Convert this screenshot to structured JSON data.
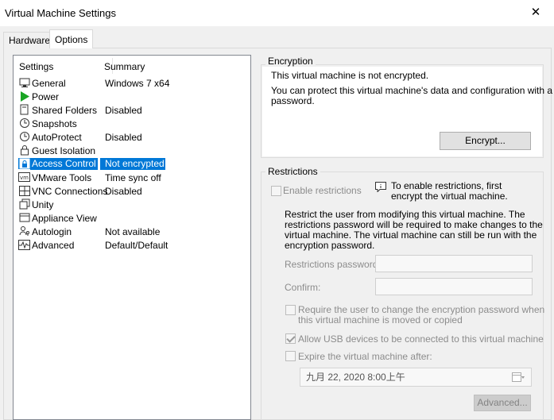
{
  "window": {
    "title": "Virtual Machine Settings"
  },
  "tabs": [
    {
      "label": "Hardware",
      "active": false
    },
    {
      "label": "Options",
      "active": true
    }
  ],
  "settings_list": {
    "columns": [
      "Settings",
      "Summary"
    ],
    "rows": [
      {
        "name": "General",
        "summary": "Windows 7 x64",
        "icon": "monitor-icon"
      },
      {
        "name": "Power",
        "summary": "",
        "icon": "play-icon"
      },
      {
        "name": "Shared Folders",
        "summary": "Disabled",
        "icon": "folder-icon"
      },
      {
        "name": "Snapshots",
        "summary": "",
        "icon": "snapshot-clock-icon"
      },
      {
        "name": "AutoProtect",
        "summary": "Disabled",
        "icon": "clock-icon"
      },
      {
        "name": "Guest Isolation",
        "summary": "",
        "icon": "lock-icon"
      },
      {
        "name": "Access Control",
        "summary": "Not encrypted",
        "icon": "access-lock-icon",
        "selected": true
      },
      {
        "name": "VMware Tools",
        "summary": "Time sync off",
        "icon": "vm-icon"
      },
      {
        "name": "VNC Connections",
        "summary": "Disabled",
        "icon": "vnc-icon"
      },
      {
        "name": "Unity",
        "summary": "",
        "icon": "window-icon"
      },
      {
        "name": "Appliance View",
        "summary": "",
        "icon": "appliance-icon"
      },
      {
        "name": "Autologin",
        "summary": "Not available",
        "icon": "user-key-icon"
      },
      {
        "name": "Advanced",
        "summary": "Default/Default",
        "icon": "pulse-icon"
      }
    ]
  },
  "encryption": {
    "heading": "Encryption",
    "status": "This virtual machine is not encrypted.",
    "description_line1": "You can protect this virtual machine's data and configuration with a",
    "description_line2": "password.",
    "encrypt_button": "Encrypt..."
  },
  "restrictions": {
    "heading": "Restrictions",
    "enable_label": "Enable restrictions",
    "tip_line1": "To enable restrictions, first",
    "tip_line2": "encrypt the virtual machine.",
    "desc_lines": [
      "Restrict the user from modifying this virtual machine. The",
      "restrictions password will be required to make changes to the",
      "virtual machine. The virtual machine can still be run with the",
      "encryption password."
    ],
    "password_label": "Restrictions password:",
    "confirm_label": "Confirm:",
    "require_change_line1": "Require the user to change the encryption password when",
    "require_change_line2": "this virtual machine is moved or copied",
    "allow_usb_label": "Allow USB devices to be connected to this virtual machine",
    "allow_usb_checked": true,
    "expire_label": "Expire the virtual machine after:",
    "expire_date": "九月  22, 2020   8:00上午",
    "advanced_button": "Advanced..."
  },
  "colors": {
    "selection": "#0078d7",
    "power_green": "#1aa524"
  }
}
